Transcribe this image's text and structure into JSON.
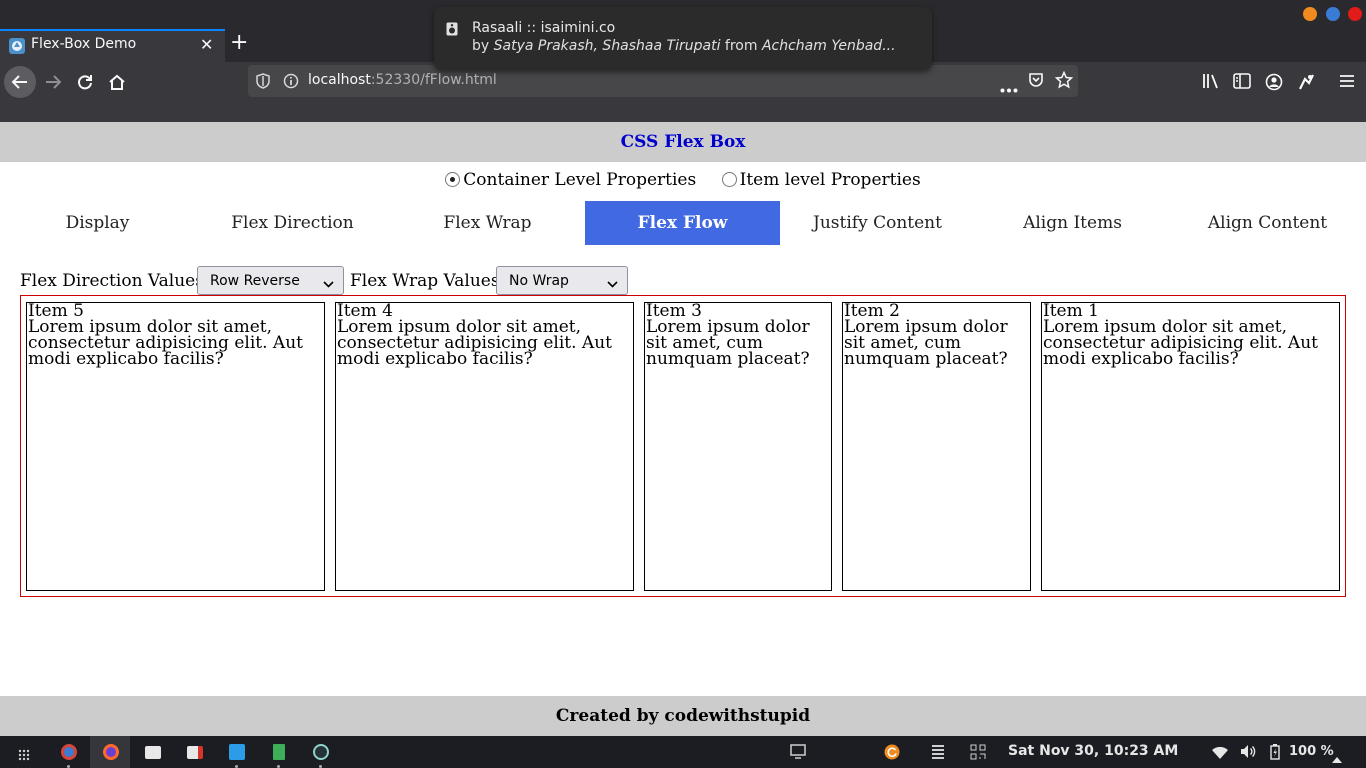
{
  "browser": {
    "tab_title": "Flex-Box Demo",
    "url_host": "localhost",
    "url_rest": ":52330/fFlow.html",
    "window_colors": [
      "#f28b1f",
      "#3a7bd5",
      "#e11a1a"
    ]
  },
  "notification": {
    "title": "Rasaali :: isaimini.co",
    "body_prefix": "by ",
    "artists": "Satya Prakash, Shashaa Tirupati",
    "body_middle": " from ",
    "album": "Achcham Yenbad..."
  },
  "page": {
    "header": "CSS Flex Box",
    "radio_container": "Container Level Properties",
    "radio_item": "Item level Properties",
    "tabs": [
      {
        "label": "Display"
      },
      {
        "label": "Flex Direction"
      },
      {
        "label": "Flex Wrap"
      },
      {
        "label": "Flex Flow"
      },
      {
        "label": "Justify Content"
      },
      {
        "label": "Align Items"
      },
      {
        "label": "Align Content"
      }
    ],
    "active_tab": "Flex Flow",
    "flex_direction_label": "Flex Direction Values",
    "flex_direction_value": "Row Reverse",
    "flex_wrap_label": "Flex Wrap Values",
    "flex_wrap_value": "No Wrap",
    "items": [
      {
        "title": "Item 5",
        "text": "Lorem ipsum dolor sit amet, consectetur adipisicing elit. Aut modi explicabo facilis?"
      },
      {
        "title": "Item 4",
        "text": "Lorem ipsum dolor sit amet, consectetur adipisicing elit. Aut modi explicabo facilis?"
      },
      {
        "title": "Item 3",
        "text": "Lorem ipsum dolor sit amet, cum numquam placeat?"
      },
      {
        "title": "Item 2",
        "text": "Lorem ipsum dolor sit amet, cum numquam placeat?"
      },
      {
        "title": "Item 1",
        "text": "Lorem ipsum dolor sit amet, consectetur adipisicing elit. Aut modi explicabo facilis?"
      }
    ],
    "footer": "Created by codewithstupid",
    "accent_color": "#4169e1"
  },
  "taskbar": {
    "clock": "Sat Nov 30, 10:23 AM",
    "battery": "100 %"
  }
}
